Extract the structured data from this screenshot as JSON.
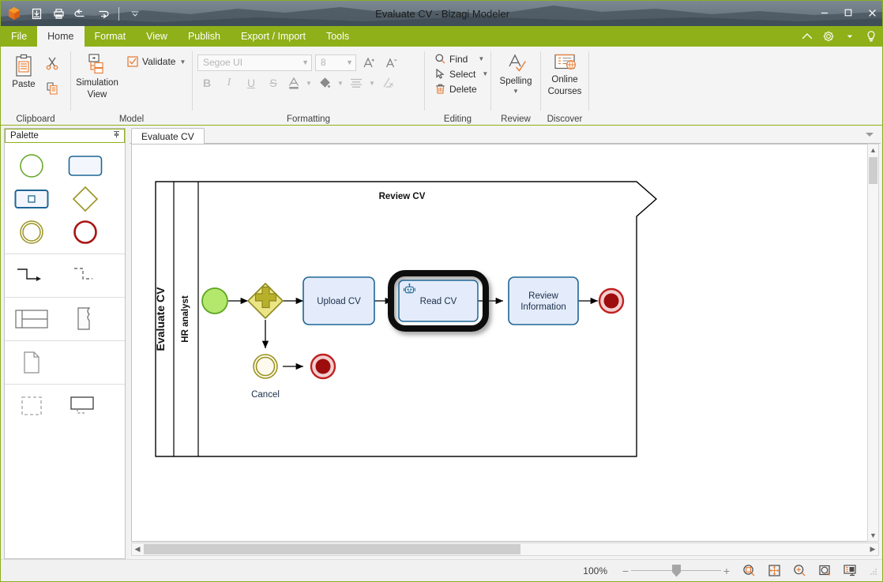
{
  "window": {
    "title": "Evaluate CV - Bizagi Modeler",
    "minimize": "minimize-button",
    "maximize": "maximize-button",
    "close": "close-button"
  },
  "quick_access": [
    {
      "name": "app-logo",
      "label": "Bizagi"
    },
    {
      "name": "save-button",
      "label": "Save"
    },
    {
      "name": "print-button",
      "label": "Print"
    },
    {
      "name": "undo-button",
      "label": "Undo"
    },
    {
      "name": "redo-button",
      "label": "Redo"
    },
    {
      "name": "customize-quick-access-button",
      "label": "Customize Quick Access Toolbar"
    }
  ],
  "ribbon": {
    "tabs": [
      {
        "label": "File",
        "active": false
      },
      {
        "label": "Home",
        "active": true
      },
      {
        "label": "Format",
        "active": false
      },
      {
        "label": "View",
        "active": false
      },
      {
        "label": "Publish",
        "active": false
      },
      {
        "label": "Export / Import",
        "active": false
      },
      {
        "label": "Tools",
        "active": false
      }
    ],
    "right_icons": [
      {
        "name": "collapse-ribbon-icon",
        "label": "Collapse the Ribbon"
      },
      {
        "name": "settings-gear-icon",
        "label": "Settings"
      },
      {
        "name": "settings-dropdown-caret",
        "label": "Settings menu"
      },
      {
        "name": "help-lightbulb-icon",
        "label": "Tell me what you want to do"
      }
    ],
    "groups": [
      {
        "title": "Clipboard",
        "paste_label": "Paste",
        "cut_label": "Cut",
        "copy_label": "Copy"
      },
      {
        "title": "Model",
        "simulation_label": "Simulation",
        "simulation_label2": "View",
        "validate_label": "Validate"
      },
      {
        "title": "Formatting",
        "font_family": "Segoe UI",
        "font_size": "8",
        "grow_font": "A",
        "shrink_font": "A",
        "bold": "B",
        "italic": "I",
        "underline": "U",
        "strikethrough": "S",
        "font_color": "A",
        "fill_color": "fill",
        "align": "align",
        "clear_format": "clear"
      },
      {
        "title": "Editing",
        "find_label": "Find",
        "select_label": "Select",
        "delete_label": "Delete"
      },
      {
        "title": "Review",
        "spelling_label": "Spelling"
      },
      {
        "title": "Discover",
        "online_courses_label": "Online",
        "online_courses_label2": "Courses"
      }
    ]
  },
  "palette": {
    "title": "Palette",
    "pin_label": "Auto Hide",
    "items": [
      {
        "name": "palette-start-event",
        "label": "Start Event"
      },
      {
        "name": "palette-task",
        "label": "Task"
      },
      {
        "name": "palette-sub-process",
        "label": "Sub-Process"
      },
      {
        "name": "palette-gateway",
        "label": "Gateway"
      },
      {
        "name": "palette-intermediate-event",
        "label": "Intermediate Event"
      },
      {
        "name": "palette-end-event",
        "label": "End Event"
      },
      {
        "name": "palette-sequence-flow",
        "label": "Sequence Flow"
      },
      {
        "name": "palette-message-flow",
        "label": "Message Flow"
      },
      {
        "name": "palette-pool",
        "label": "Pool / Lane"
      },
      {
        "name": "palette-annotation",
        "label": "Annotation"
      },
      {
        "name": "palette-data-object",
        "label": "Data Object"
      },
      {
        "name": "palette-group",
        "label": "Group"
      },
      {
        "name": "palette-text-annotation",
        "label": "Text Annotation"
      }
    ]
  },
  "document": {
    "tab_label": "Evaluate CV",
    "tab_dropdown": "document-tabs-dropdown"
  },
  "diagram": {
    "pool_label": "Evaluate CV",
    "lane_label": "HR analyst",
    "process_title": "Review CV",
    "nodes": [
      {
        "id": "start",
        "type": "start-event",
        "label": ""
      },
      {
        "id": "gateway",
        "type": "parallel-gateway",
        "label": ""
      },
      {
        "id": "upload",
        "type": "task",
        "label": "Upload CV"
      },
      {
        "id": "read",
        "type": "service-task",
        "label": "Read CV",
        "selected": true,
        "icon": "robot-icon"
      },
      {
        "id": "review",
        "type": "task",
        "label": "Review\nInformation"
      },
      {
        "id": "end1",
        "type": "end-event",
        "label": ""
      },
      {
        "id": "cancel",
        "type": "intermediate-event",
        "label": "Cancel"
      },
      {
        "id": "end2",
        "type": "end-event",
        "label": ""
      }
    ],
    "node_labels": {
      "upload": "Upload CV",
      "read": "Read CV",
      "review_line1": "Review",
      "review_line2": "Information",
      "cancel": "Cancel"
    },
    "colors": {
      "task_fill": "#e4ecfb",
      "task_stroke": "#1f6695",
      "start_fill": "#b4e86c",
      "start_stroke": "#5fa524",
      "gateway_fill": "#ebe585",
      "gateway_stroke": "#9a9424",
      "end_fill": "#a10f0f",
      "end_stroke": "#c02222",
      "intermediate_fill": "#fdf9ec",
      "intermediate_stroke": "#9a9424",
      "selection": "#000000"
    }
  },
  "status": {
    "zoom_level": "100%",
    "zoom_minus": "−",
    "zoom_plus": "+",
    "icons": [
      {
        "name": "zoom-to-selection-icon",
        "label": "Zoom to selection"
      },
      {
        "name": "fit-to-page-icon",
        "label": "Fit to page"
      },
      {
        "name": "zoom-in-icon",
        "label": "Zoom in"
      },
      {
        "name": "zoom-to-window-icon",
        "label": "Zoom to window"
      },
      {
        "name": "presentation-view-icon",
        "label": "Presentation view"
      }
    ]
  },
  "scrollbars": {
    "horizontal": "horizontal-scrollbar",
    "vertical": "vertical-scrollbar"
  }
}
